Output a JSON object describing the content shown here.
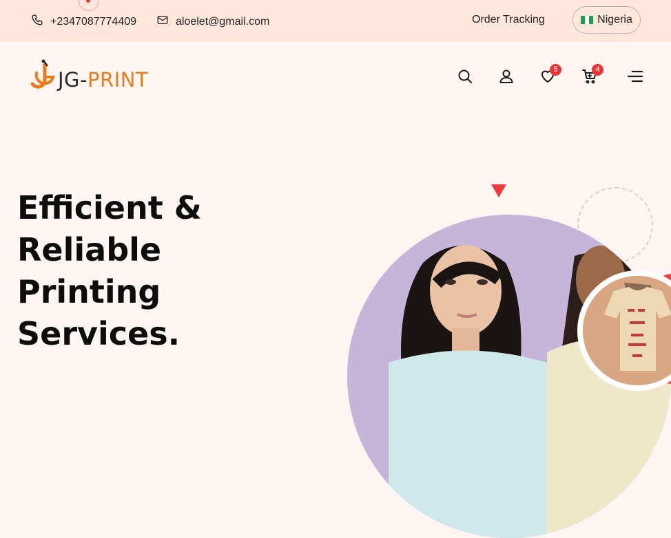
{
  "topbar": {
    "phone": "+2347087774409",
    "email": "aloelet@gmail.com",
    "order_tracking": "Order Tracking",
    "country": "Nigeria"
  },
  "header": {
    "logo_jg": "JG-",
    "logo_print": "PRINT",
    "wishlist_count": "5",
    "cart_count": "4",
    "icons": [
      "search-icon",
      "user-icon",
      "heart-icon",
      "cart-icon",
      "menu-icon"
    ]
  },
  "hero": {
    "title": "Efficient &\nReliable\nPrinting\nServices."
  },
  "colors": {
    "accent_red": "#ef3b3b",
    "brand_orange": "#ea7a1e",
    "topbar_bg": "#ffe7dc",
    "page_bg": "#fff6f3"
  }
}
